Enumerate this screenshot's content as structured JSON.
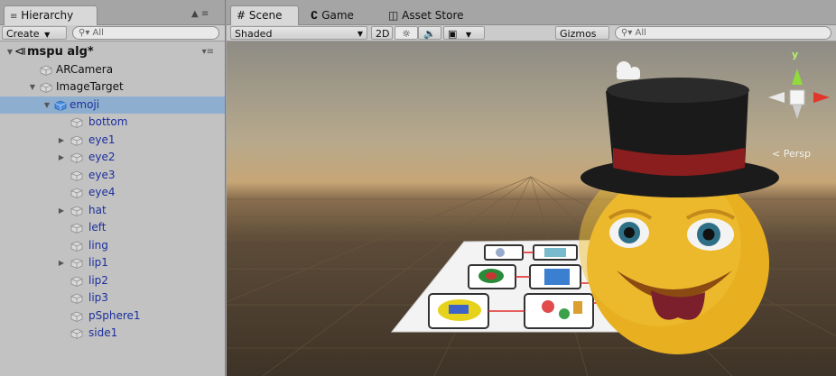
{
  "hierarchy": {
    "tab_label": "Hierarchy",
    "lock_menu": "▲ ≡",
    "create_label": "Create",
    "search_placeholder": "All",
    "scene_name": "mspu alg*",
    "items": [
      {
        "label": "ARCamera"
      },
      {
        "label": "ImageTarget"
      },
      {
        "label": "emoji"
      },
      {
        "label": "bottom"
      },
      {
        "label": "eye1"
      },
      {
        "label": "eye2"
      },
      {
        "label": "eye3"
      },
      {
        "label": "eye4"
      },
      {
        "label": "hat"
      },
      {
        "label": "left"
      },
      {
        "label": "ling"
      },
      {
        "label": "lip1"
      },
      {
        "label": "lip2"
      },
      {
        "label": "lip3"
      },
      {
        "label": "pSphere1"
      },
      {
        "label": "side1"
      }
    ]
  },
  "scene": {
    "tabs": [
      {
        "label": "Scene"
      },
      {
        "label": "Game"
      },
      {
        "label": "Asset Store"
      }
    ],
    "shading_mode": "Shaded",
    "mode_2d": "2D",
    "gizmos_label": "Gizmos",
    "search_placeholder": "All",
    "persp_label": "Persp",
    "axis_y": "y"
  },
  "colors": {
    "selection": "#8eaecf",
    "child_text": "#1c2f9c",
    "hat_band": "#8a1d1d",
    "emoji_face": "#e8b020",
    "tongue": "#7a1f2b"
  }
}
